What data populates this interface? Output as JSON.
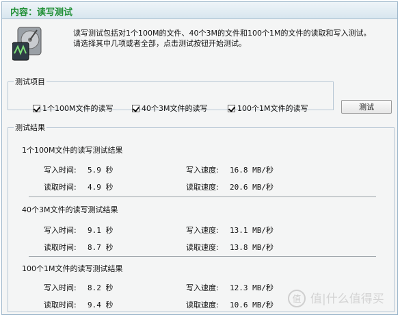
{
  "header": {
    "title": "内容：读写测试"
  },
  "description": "读写测试包括对1个100M的文件、40个3M的文件和100个1M的文件的读取和写入测试。请选择其中几项或者全部，点击测试按钮开始测试。",
  "test_items": {
    "legend": "测试项目",
    "options": [
      {
        "label": "1个100M文件的读写",
        "checked": true
      },
      {
        "label": "40个3M文件的读写",
        "checked": true
      },
      {
        "label": "100个1M文件的读写",
        "checked": true
      }
    ]
  },
  "test_button": {
    "label": "测试"
  },
  "results": {
    "legend": "测试结果",
    "sections": [
      {
        "title": "1个100M文件的读写测试结果",
        "write_time_label": "写入时间:",
        "write_time": "5.9 秒",
        "write_speed_label": "写入速度:",
        "write_speed": "16.8 MB/秒",
        "read_time_label": "读取时间:",
        "read_time": "4.9 秒",
        "read_speed_label": "读取速度:",
        "read_speed": "20.6 MB/秒"
      },
      {
        "title": "40个3M文件的读写测试结果",
        "write_time_label": "写入时间:",
        "write_time": "9.1 秒",
        "write_speed_label": "写入速度:",
        "write_speed": "13.1 MB/秒",
        "read_time_label": "读取时间:",
        "read_time": "8.7 秒",
        "read_speed_label": "读取速度:",
        "read_speed": "13.8 MB/秒"
      },
      {
        "title": "100个1M文件的读写测试结果",
        "write_time_label": "写入时间:",
        "write_time": "8.2 秒",
        "write_speed_label": "写入速度:",
        "write_speed": "12.3 MB/秒",
        "read_time_label": "读取时间:",
        "read_time": "9.4 秒",
        "read_speed_label": "读取速度:",
        "read_speed": "10.6 MB/秒"
      }
    ]
  },
  "watermark": {
    "text": "值|什么值得买"
  },
  "icons": {
    "app_icon": "hard-disk-icon",
    "watermark_icon": "smzdm-logo-icon"
  },
  "colors": {
    "title_green": "#1f8f35",
    "border_blue": "#9fb8cc"
  }
}
